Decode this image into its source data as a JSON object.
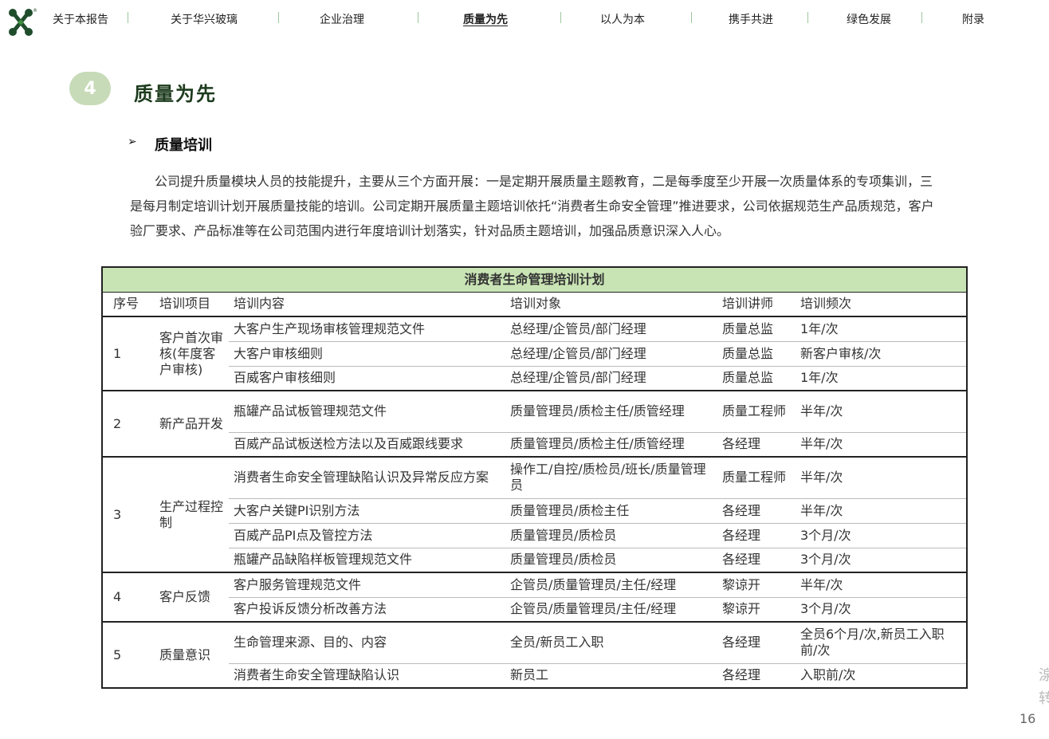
{
  "nav": {
    "logo_icon": "huaxing-logo-icon",
    "items": [
      {
        "label": "关于本报告"
      },
      {
        "label": "关于华兴玻璃"
      },
      {
        "label": "企业治理"
      },
      {
        "label": "质量为先"
      },
      {
        "label": "以人为本"
      },
      {
        "label": "携手共进"
      },
      {
        "label": "绿色发展"
      },
      {
        "label": "附录"
      }
    ],
    "active_index": 3,
    "accent_color": "#1f4d2c"
  },
  "section": {
    "number": "4",
    "title": "质量为先",
    "badge_color": "#c7dbb8"
  },
  "subsection": {
    "bullet": "➢",
    "title": "质量培训"
  },
  "paragraph": "公司提升质量模块人员的技能提升，主要从三个方面开展：一是定期开展质量主题教育，二是每季度至少开展一次质量体系的专项集训，三是每月制定培训计划开展质量技能的培训。公司定期开展质量主题培训依托“消费者生命安全管理”推进要求，公司依据规范生产品质规范，客户验厂要求、产品标准等在公司范围内进行年度培训计划落实，针对品质主题培训，加强品质意识深入人心。",
  "table": {
    "caption": "消费者生命管理培训计划",
    "header_color": "#c9e4b4",
    "columns": [
      "序号",
      "培训项目",
      "培训内容",
      "培训对象",
      "培训讲师",
      "培训频次"
    ],
    "groups": [
      {
        "no": "1",
        "project": "客户首次审核(年度客户审核)",
        "rows": [
          {
            "content": "大客户生产现场审核管理规范文件",
            "target": "总经理/企管员/部门经理",
            "lecturer": "质量总监",
            "frequency": "1年/次"
          },
          {
            "content": "大客户审核细则",
            "target": "总经理/企管员/部门经理",
            "lecturer": "质量总监",
            "frequency": "新客户审核/次"
          },
          {
            "content": "百威客户审核细则",
            "target": "总经理/企管员/部门经理",
            "lecturer": "质量总监",
            "frequency": "1年/次"
          }
        ]
      },
      {
        "no": "2",
        "project": "新产品开发",
        "rows": [
          {
            "content": "瓶罐产品试板管理规范文件",
            "target": "质量管理员/质检主任/质管经理",
            "lecturer": "质量工程师",
            "frequency": "半年/次"
          },
          {
            "content": "百威产品试板送检方法以及百威跟线要求",
            "target": "质量管理员/质检主任/质管经理",
            "lecturer": "各经理",
            "frequency": "半年/次"
          }
        ]
      },
      {
        "no": "3",
        "project": "生产过程控制",
        "rows": [
          {
            "content": "消费者生命安全管理缺陷认识及异常反应方案",
            "target": "操作工/自控/质检员/班长/质量管理员",
            "lecturer": "质量工程师",
            "frequency": "半年/次"
          },
          {
            "content": "大客户关键PI识别方法",
            "target": "质量管理员/质检主任",
            "lecturer": "各经理",
            "frequency": "半年/次"
          },
          {
            "content": "百威产品PI点及管控方法",
            "target": "质量管理员/质检员",
            "lecturer": "各经理",
            "frequency": "3个月/次"
          },
          {
            "content": "瓶罐产品缺陷样板管理规范文件",
            "target": "质量管理员/质检员",
            "lecturer": "各经理",
            "frequency": "3个月/次"
          }
        ]
      },
      {
        "no": "4",
        "project": "客户反馈",
        "rows": [
          {
            "content": "客户服务管理规范文件",
            "target": "企管员/质量管理员/主任/经理",
            "lecturer": "黎谅开",
            "frequency": "半年/次"
          },
          {
            "content": "客户投诉反馈分析改善方法",
            "target": "企管员/质量管理员/主任/经理",
            "lecturer": "黎谅开",
            "frequency": "3个月/次"
          }
        ]
      },
      {
        "no": "5",
        "project": "质量意识",
        "rows": [
          {
            "content": "生命管理来源、目的、内容",
            "target": "全员/新员工入职",
            "lecturer": "各经理",
            "frequency": "全员6个月/次,新员工入职前/次"
          },
          {
            "content": "消费者生命安全管理缺陷认识",
            "target": "新员工",
            "lecturer": "各经理",
            "frequency": "入职前/次"
          }
        ]
      }
    ]
  },
  "page_number": "16",
  "edge_text": [
    "湶",
    "转"
  ]
}
